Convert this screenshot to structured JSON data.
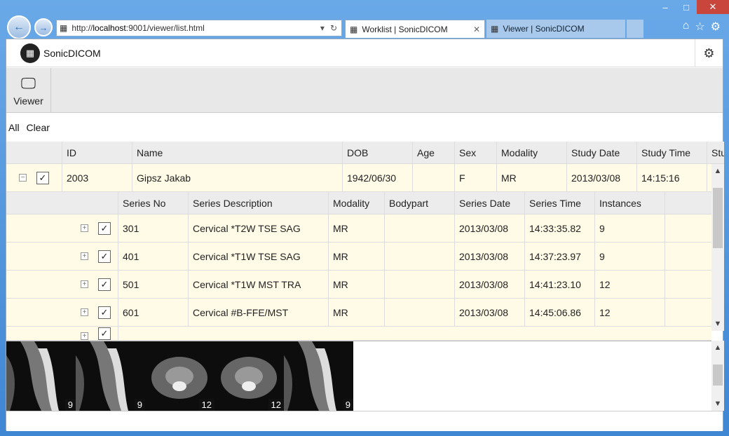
{
  "browser": {
    "url_prefix": "http://",
    "url_host": "localhost",
    "url_rest": ":9001/viewer/list.html",
    "tabs": [
      {
        "label": "Worklist | SonicDICOM",
        "active": true
      },
      {
        "label": "Viewer | SonicDICOM",
        "active": false
      }
    ]
  },
  "app": {
    "name": "SonicDICOM",
    "toolbar": {
      "viewer_label": "Viewer"
    },
    "filters": {
      "all": "All",
      "clear": "Clear"
    }
  },
  "study_table": {
    "headers": [
      "ID",
      "Name",
      "DOB",
      "Age",
      "Sex",
      "Modality",
      "Study Date",
      "Study Time",
      "Stu"
    ],
    "row": {
      "id": "2003",
      "name": "Gipsz Jakab",
      "dob": "1942/06/30",
      "age": "",
      "sex": "F",
      "modality": "MR",
      "study_date": "2013/03/08",
      "study_time": "14:15:16"
    }
  },
  "series_table": {
    "headers": [
      "Series No",
      "Series Description",
      "Modality",
      "Bodypart",
      "Series Date",
      "Series Time",
      "Instances"
    ],
    "rows": [
      {
        "no": "301",
        "desc": "Cervical *T2W TSE SAG",
        "modality": "MR",
        "bodypart": "",
        "date": "2013/03/08",
        "time": "14:33:35.82",
        "instances": "9"
      },
      {
        "no": "401",
        "desc": "Cervical *T1W TSE SAG",
        "modality": "MR",
        "bodypart": "",
        "date": "2013/03/08",
        "time": "14:37:23.97",
        "instances": "9"
      },
      {
        "no": "501",
        "desc": "Cervical *T1W MST TRA",
        "modality": "MR",
        "bodypart": "",
        "date": "2013/03/08",
        "time": "14:41:23.10",
        "instances": "12"
      },
      {
        "no": "601",
        "desc": "Cervical #B-FFE/MST",
        "modality": "MR",
        "bodypart": "",
        "date": "2013/03/08",
        "time": "14:45:06.86",
        "instances": "12"
      }
    ]
  },
  "thumbnails": [
    {
      "count": "9",
      "kind": "sag"
    },
    {
      "count": "9",
      "kind": "sag"
    },
    {
      "count": "12",
      "kind": "tra"
    },
    {
      "count": "12",
      "kind": "tra"
    },
    {
      "count": "9",
      "kind": "sag"
    }
  ]
}
